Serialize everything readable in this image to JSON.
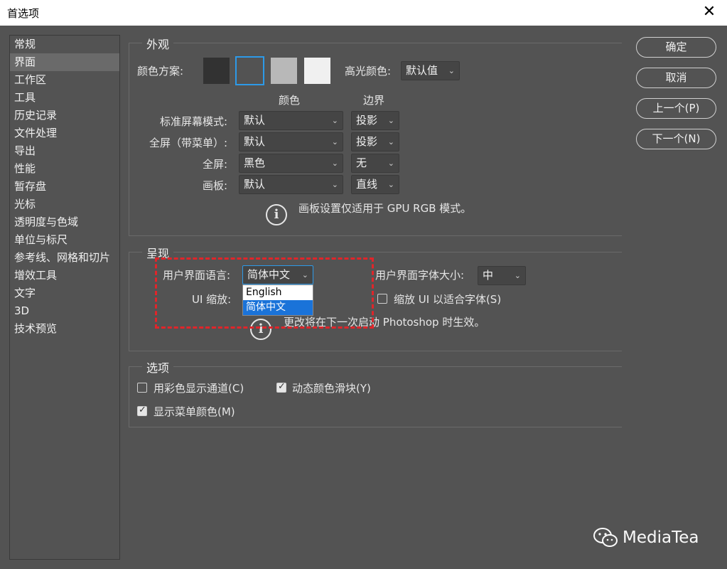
{
  "window": {
    "title": "首选项"
  },
  "sidebar": {
    "items": [
      {
        "label": "常规"
      },
      {
        "label": "界面",
        "selected": true
      },
      {
        "label": "工作区"
      },
      {
        "label": "工具"
      },
      {
        "label": "历史记录"
      },
      {
        "label": "文件处理"
      },
      {
        "label": "导出"
      },
      {
        "label": "性能"
      },
      {
        "label": "暂存盘"
      },
      {
        "label": "光标"
      },
      {
        "label": "透明度与色域"
      },
      {
        "label": "单位与标尺"
      },
      {
        "label": "参考线、网格和切片"
      },
      {
        "label": "增效工具"
      },
      {
        "label": "文字"
      },
      {
        "label": "3D"
      },
      {
        "label": "技术预览"
      }
    ]
  },
  "appearance": {
    "title": "外观",
    "color_scheme_label": "颜色方案:",
    "swatch_colors": [
      "#323232",
      "#535353",
      "#b8b8b8",
      "#f0f0f0"
    ],
    "selected_swatch": 1,
    "highlight_label": "高光颜色:",
    "highlight_value": "默认值",
    "col_color": "颜色",
    "col_border": "边界",
    "rows": [
      {
        "label": "标准屏幕模式:",
        "color": "默认",
        "border": "投影"
      },
      {
        "label": "全屏（带菜单）:",
        "color": "默认",
        "border": "投影"
      },
      {
        "label": "全屏:",
        "color": "黑色",
        "border": "无"
      },
      {
        "label": "画板:",
        "color": "默认",
        "border": "直线"
      }
    ],
    "note": "画板设置仅适用于 GPU RGB 模式。"
  },
  "presentation": {
    "title": "呈现",
    "ui_language_label": "用户界面语言:",
    "ui_language_value": "简体中文",
    "ui_language_options": [
      "English",
      "简体中文"
    ],
    "ui_font_size_label": "用户界面字体大小:",
    "ui_font_size_value": "中",
    "ui_scale_label": "UI 缩放:",
    "scale_to_font_label": "缩放 UI 以适合字体(S)",
    "scale_to_font_checked": false,
    "note": "更改将在下一次启动 Photoshop 时生效。"
  },
  "options": {
    "title": "选项",
    "color_channels_label": "用彩色显示通道(C)",
    "color_channels_checked": false,
    "dynamic_sliders_label": "动态颜色滑块(Y)",
    "dynamic_sliders_checked": true,
    "menu_colors_label": "显示菜单颜色(M)",
    "menu_colors_checked": true
  },
  "buttons": {
    "ok": "确定",
    "cancel": "取消",
    "prev": "上一个(P)",
    "next": "下一个(N)"
  },
  "watermark": {
    "text": "MediaTea"
  },
  "colors": {
    "accent": "#2d9ae8",
    "highlight_border": "#e0252a",
    "dropdown_active": "#1a73d9"
  }
}
